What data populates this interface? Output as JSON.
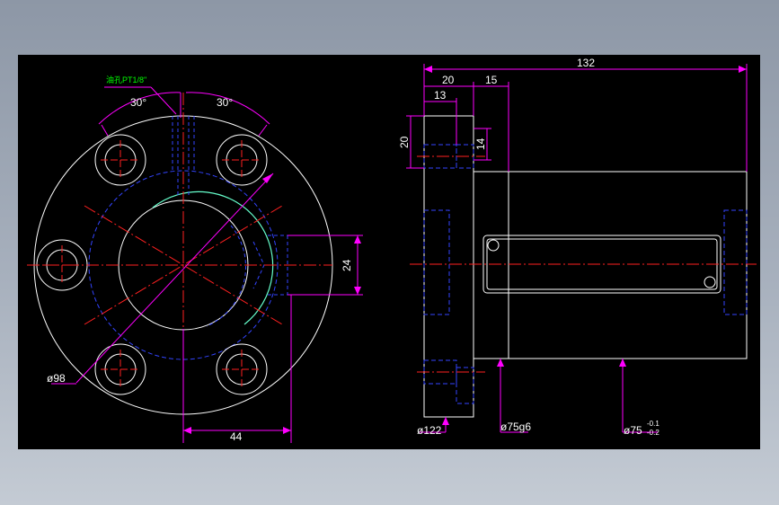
{
  "colors": {
    "background": "#000000",
    "outline": "#ffffff",
    "hidden": "#3344ff",
    "center": "#ff2020",
    "dimension": "#ff00ff",
    "note": "#00ff00",
    "thread": "#66ffcc"
  },
  "front_view": {
    "note_label": "油孔PT1/8\"",
    "angle_left": "30°",
    "angle_right": "30°",
    "dim_height": "24",
    "dim_width": "44",
    "dim_diameter": "ø98"
  },
  "side_view": {
    "dim_overall": "132",
    "dim_flange": "20",
    "dim_step": "15",
    "dim_hole_depth": "13",
    "dim_hole_height": "20",
    "dim_hole_dia": "14",
    "dim_flange_dia": "ø122",
    "dim_fit_dia": "ø75g6",
    "dim_body_dia": "ø75",
    "tol_upper": "-0.1",
    "tol_lower": "-0.2"
  }
}
